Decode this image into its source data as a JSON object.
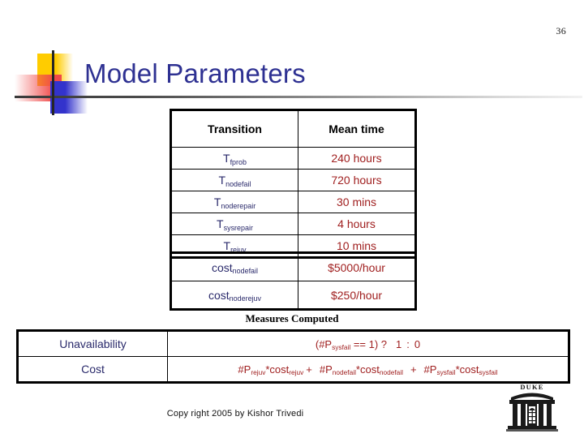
{
  "slide": {
    "page_number": "36",
    "title": "Model Parameters",
    "copyright": "Copy right 2005 by Kishor Trivedi",
    "title_color": "#2E3192",
    "value_color": "#A02020",
    "label_color": "#2A2A6B"
  },
  "logo_mark": {
    "yellow": "#FFCC00",
    "red": "#F04A4A",
    "blue": "#3333CC",
    "line": "#262626"
  },
  "params_table": {
    "headers": [
      "Transition",
      "Mean time"
    ],
    "rows": [
      {
        "name_base": "T",
        "name_sub": "fprob",
        "mean_time": "240 hours"
      },
      {
        "name_base": "T",
        "name_sub": "nodefail",
        "mean_time": "720 hours"
      },
      {
        "name_base": "T",
        "name_sub": "noderepair",
        "mean_time": "30 mins"
      },
      {
        "name_base": "T",
        "name_sub": "sysrepair",
        "mean_time": "4 hours"
      },
      {
        "name_base": "T",
        "name_sub": "rejuv",
        "mean_time": "10 mins"
      }
    ]
  },
  "cost_table": {
    "rows": [
      {
        "name_base": "cost",
        "name_sub": "nodefail",
        "value": "$5000/hour"
      },
      {
        "name_base": "cost",
        "name_sub": "noderejuv",
        "value": "$250/hour"
      }
    ]
  },
  "measures": {
    "heading": "Measures Computed",
    "unavailability": {
      "label": "Unavailability",
      "f_open": "(#P",
      "f_sub": "sysfail",
      "f_cond": " == 1) ?",
      "f_true": "1",
      "f_colon": ":",
      "f_false": "0"
    },
    "cost": {
      "label": "Cost",
      "terms": [
        {
          "p": "#P",
          "p_sub": "rejuv",
          "mul": "*cost",
          "c_sub": "rejuv"
        },
        {
          "p": "#P",
          "p_sub": "nodefail",
          "mul": "*cost",
          "c_sub": "nodefail"
        },
        {
          "p": "#P",
          "p_sub": "sysfail",
          "mul": "*cost",
          "c_sub": "sysfail"
        }
      ],
      "plus": "+"
    }
  },
  "duke_logo": {
    "wordmark": "DUKE"
  }
}
